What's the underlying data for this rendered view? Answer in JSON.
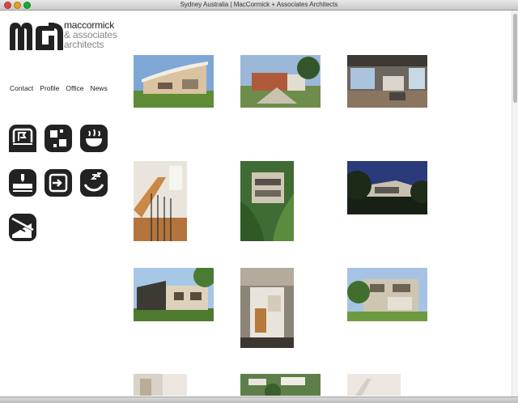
{
  "window": {
    "title": "Sydney Australia | MacCormick + Associates Architects"
  },
  "logo": {
    "line1": "maccormick",
    "line2": "& associates",
    "line3": "architects",
    "mark_icon": "ma-monogram-icon"
  },
  "nav": {
    "items": [
      "Contact",
      "Profile",
      "Office",
      "News"
    ]
  },
  "icons": [
    {
      "name": "flag-icon"
    },
    {
      "name": "blocks-icon"
    },
    {
      "name": "bowl-icon"
    },
    {
      "name": "plate-icon"
    },
    {
      "name": "enter-icon"
    },
    {
      "name": "sleep-icon"
    },
    {
      "name": "stairs-icon"
    }
  ],
  "photos": [
    {
      "alt": "curved roof house with lawn"
    },
    {
      "alt": "garden courtyard house"
    },
    {
      "alt": "living room interior"
    },
    {
      "alt": "timber staircase"
    },
    {
      "alt": "house in tropical garden"
    },
    {
      "alt": "house at dusk among trees"
    },
    {
      "alt": "house facade with palm trees"
    },
    {
      "alt": "doorway with timber stair"
    },
    {
      "alt": "two-storey house with lawn"
    },
    {
      "alt": "interior corner"
    },
    {
      "alt": "aerial view of houses"
    },
    {
      "alt": "pale interior"
    }
  ],
  "colors": {
    "brand_dark": "#222222",
    "brand_grey": "#888888",
    "background": "#ffffff"
  }
}
